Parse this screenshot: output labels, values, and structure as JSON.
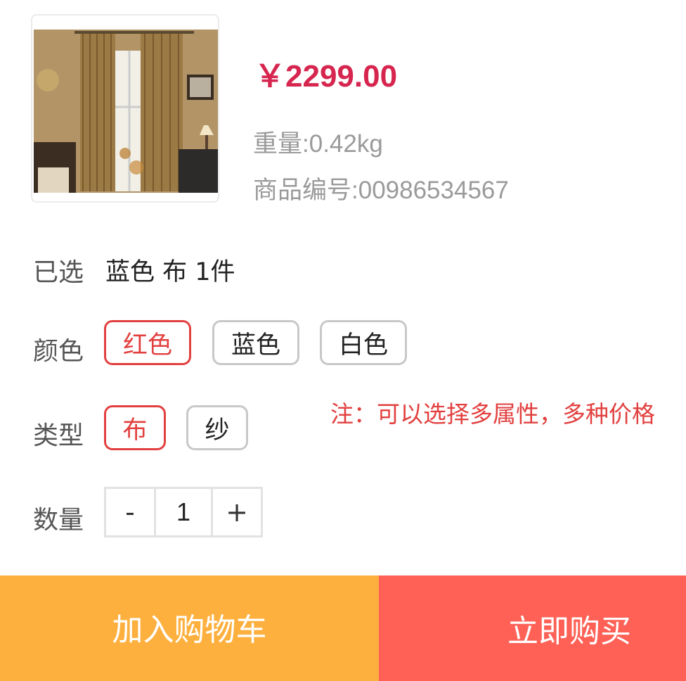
{
  "product": {
    "image_icon": "curtain-product-photo",
    "price": "￥2299.00",
    "weight": "重量:0.42kg",
    "sku": "商品编号:00986534567"
  },
  "selected": {
    "label": "已选",
    "value": "蓝色 布 1件"
  },
  "color": {
    "label": "颜色",
    "options": [
      "红色",
      "蓝色",
      "白色"
    ],
    "selected_index": 0
  },
  "type": {
    "label": "类型",
    "options": [
      "布",
      "纱"
    ],
    "selected_index": 0
  },
  "note": "注：可以选择多属性，多种价格",
  "quantity": {
    "label": "数量",
    "minus": "-",
    "value": "1",
    "plus": "+"
  },
  "actions": {
    "add_to_cart": "加入购物车",
    "buy_now": "立即购买",
    "cart_color": "#fdb03e",
    "buy_color": "#ff6156"
  },
  "colors": {
    "price": "#d6264f",
    "accent": "#e2403f"
  }
}
